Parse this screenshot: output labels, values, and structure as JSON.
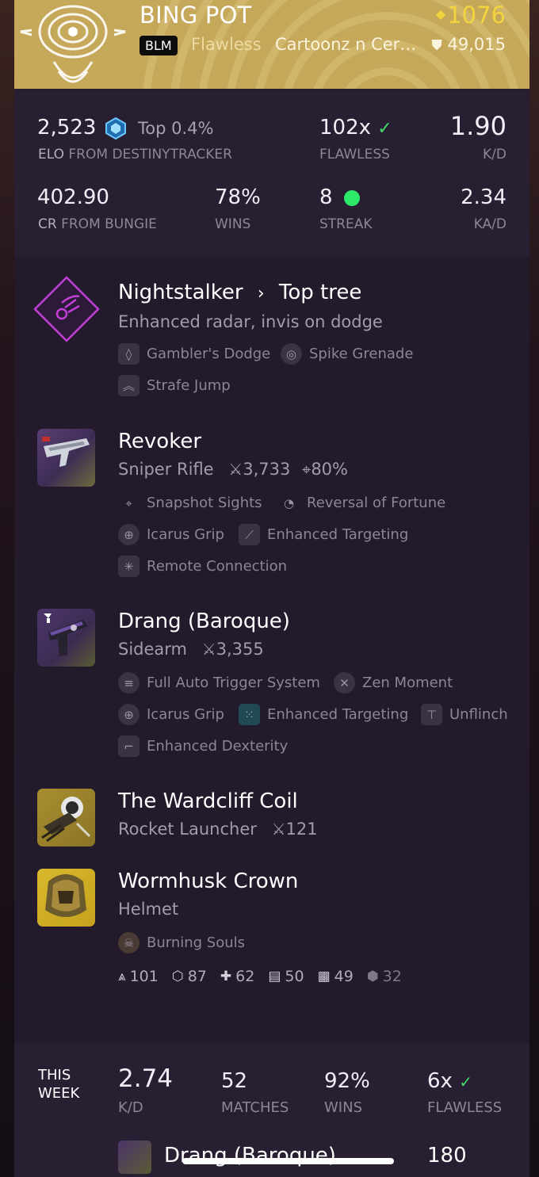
{
  "header": {
    "player_name": "BING POT",
    "light_level": "1076",
    "clan_tag": "BLM",
    "title": "Flawless",
    "clan_name": "Cartoonz n Cer…",
    "glory": "49,015"
  },
  "stats": {
    "elo": {
      "value": "2,523",
      "rank": "Top 0.4%",
      "label_prefix": "ELO",
      "label_source": "FROM DESTINYTRACKER"
    },
    "flawless": {
      "value": "102x",
      "label": "FLAWLESS"
    },
    "kd": {
      "value": "1.90",
      "label": "K/D"
    },
    "cr": {
      "value": "402.90",
      "label_prefix": "CR",
      "label_source": "FROM BUNGIE"
    },
    "wins": {
      "value": "78%",
      "label": "WINS"
    },
    "streak": {
      "value": "8",
      "label": "STREAK"
    },
    "kad": {
      "value": "2.34",
      "label": "KA/D"
    }
  },
  "subclass": {
    "name": "Nightstalker",
    "tree": "Top tree",
    "description": "Enhanced radar, invis on dodge",
    "perks": [
      "Gambler's Dodge",
      "Spike Grenade",
      "Strafe Jump"
    ]
  },
  "weapons": [
    {
      "name": "Revoker",
      "type": "Sniper Rifle",
      "kills": "3,733",
      "precision": "80%",
      "perks": [
        "Snapshot Sights",
        "Reversal of Fortune",
        "Icarus Grip",
        "Enhanced Targeting",
        "Remote Connection"
      ]
    },
    {
      "name": "Drang (Baroque)",
      "type": "Sidearm",
      "kills": "3,355",
      "perks": [
        "Full Auto Trigger System",
        "Zen Moment",
        "Icarus Grip",
        "Enhanced Targeting",
        "Unflinch",
        "Enhanced Dexterity"
      ]
    },
    {
      "name": "The Wardcliff Coil",
      "type": "Rocket Launcher",
      "kills": "121"
    }
  ],
  "armor": {
    "name": "Wormhusk Crown",
    "type": "Helmet",
    "perk": "Burning Souls",
    "stats": [
      "101",
      "87",
      "62",
      "50",
      "49",
      "32"
    ]
  },
  "this_week": {
    "label_line1": "THIS",
    "label_line2": "WEEK",
    "kd": {
      "value": "2.74",
      "label": "K/D"
    },
    "matches": {
      "value": "52",
      "label": "MATCHES"
    },
    "wins": {
      "value": "92%",
      "label": "WINS"
    },
    "flawless": {
      "value": "6x",
      "label": "FLAWLESS"
    },
    "top_weapon": {
      "name": "Drang (Baroque)",
      "kills": "180"
    }
  },
  "colors": {
    "header_gold": "#c5a85a",
    "light_yellow": "#f3d33e",
    "void_purple": "#c13fd6",
    "check_green": "#3ddc6e",
    "streak_green": "#2ee86a"
  }
}
